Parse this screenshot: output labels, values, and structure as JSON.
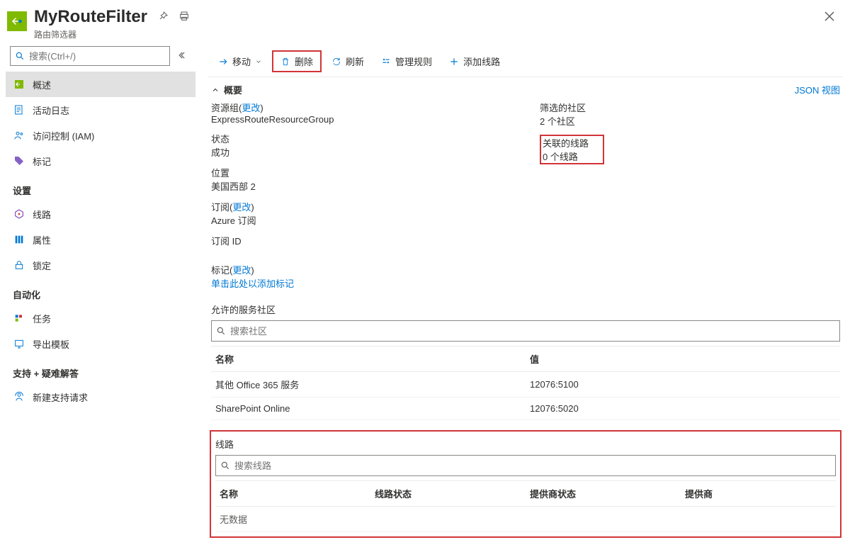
{
  "header": {
    "title": "MyRouteFilter",
    "subtitle": "路由筛选器"
  },
  "sidebar": {
    "search_placeholder": "搜索(Ctrl+/)",
    "items": [
      {
        "label": "概述"
      },
      {
        "label": "活动日志"
      },
      {
        "label": "访问控制 (IAM)"
      },
      {
        "label": "标记"
      }
    ],
    "sections": {
      "settings": {
        "title": "设置",
        "items": [
          {
            "label": "线路"
          },
          {
            "label": "属性"
          },
          {
            "label": "锁定"
          }
        ]
      },
      "automation": {
        "title": "自动化",
        "items": [
          {
            "label": "任务"
          },
          {
            "label": "导出模板"
          }
        ]
      },
      "support": {
        "title": "支持 + 疑难解答",
        "items": [
          {
            "label": "新建支持请求"
          }
        ]
      }
    }
  },
  "toolbar": {
    "move": "移动",
    "delete": "删除",
    "refresh": "刷新",
    "manage_rules": "管理规则",
    "add_circuit": "添加线路"
  },
  "overview": {
    "header": "概要",
    "json_view": "JSON 视图",
    "change": "更改",
    "left": {
      "resource_group_label": "资源组",
      "resource_group_value": "ExpressRouteResourceGroup",
      "status_label": "状态",
      "status_value": "成功",
      "location_label": "位置",
      "location_value": "美国西部 2",
      "subscription_label": "订阅",
      "subscription_value": "Azure 订阅",
      "subscription_id_label": "订阅 ID"
    },
    "right": {
      "communities_label": "筛选的社区",
      "communities_value": "2 个社区",
      "circuits_label": "关联的线路",
      "circuits_value": "0 个线路"
    },
    "tags_label": "标记",
    "tags_add": "单击此处以添加标记"
  },
  "communities": {
    "section_title": "允许的服务社区",
    "search_placeholder": "搜索社区",
    "headers": {
      "name": "名称",
      "value": "值"
    },
    "rows": [
      {
        "name": "其他 Office 365 服务",
        "value": "12076:5100"
      },
      {
        "name": "SharePoint Online",
        "value": "12076:5020"
      }
    ]
  },
  "circuits": {
    "section_title": "线路",
    "search_placeholder": "搜索线路",
    "headers": {
      "name": "名称",
      "circuit_status": "线路状态",
      "provider_status": "提供商状态",
      "provider": "提供商"
    },
    "nodata": "无数据"
  }
}
